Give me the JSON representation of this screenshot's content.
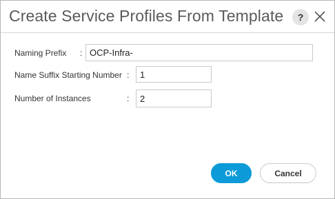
{
  "dialog": {
    "title": "Create Service Profiles From Template",
    "help_icon": "question-mark-icon",
    "help_label": "?",
    "close_icon": "close-icon"
  },
  "form": {
    "naming_prefix": {
      "label": "Naming Prefix",
      "colon": ":",
      "value": "OCP-Infra-"
    },
    "suffix_start": {
      "label": "Name Suffix Starting Number",
      "colon": ":",
      "value": "1"
    },
    "instances": {
      "label": "Number of Instances",
      "colon": ":",
      "value": "2"
    }
  },
  "actions": {
    "ok_label": "OK",
    "cancel_label": "Cancel"
  },
  "colors": {
    "primary": "#0c9bd8",
    "title_text": "#5a5a5a"
  }
}
